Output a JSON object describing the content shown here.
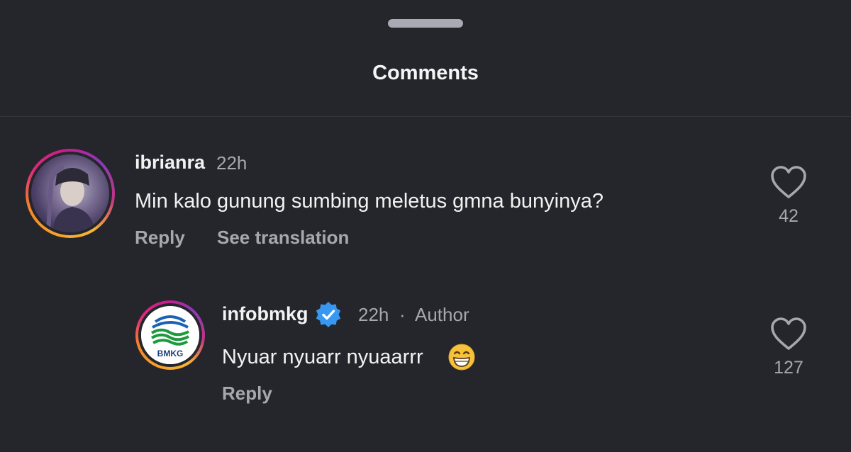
{
  "sheet": {
    "title": "Comments"
  },
  "comments": [
    {
      "username": "ibrianra",
      "time": "22h",
      "text": "Min kalo gunung sumbing meletus gmna bunyinya?",
      "reply_label": "Reply",
      "translate_label": "See translation",
      "likes": "42"
    },
    {
      "username": "infobmkg",
      "time": "22h",
      "separator": "·",
      "author_label": "Author",
      "text": "Nyuar nyuarr nyuaarrr",
      "reply_label": "Reply",
      "likes": "127",
      "avatar_text": "BMKG",
      "verified": true
    }
  ],
  "colors": {
    "background": "#24262b",
    "primary_text": "#f2f2f2",
    "secondary_text": "#a5a8ae",
    "verified_blue": "#3897f0"
  },
  "icons": {
    "like": "heart-outline-icon",
    "verified": "verified-badge-icon",
    "emoji": "grinning-face-emoji"
  }
}
